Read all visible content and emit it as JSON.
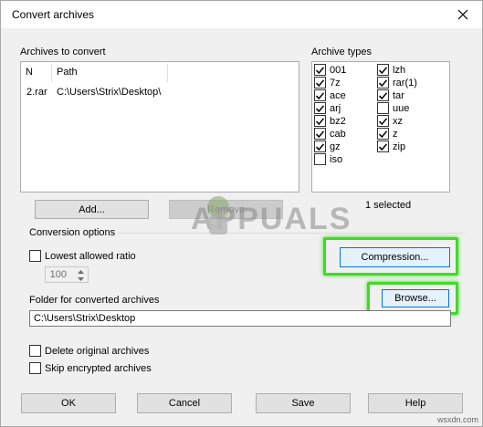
{
  "window": {
    "title": "Convert archives"
  },
  "archives": {
    "label": "Archives to convert",
    "columns": {
      "n": "N",
      "path": "Path"
    },
    "rows": [
      {
        "n": "2.rar",
        "path": "C:\\Users\\Strix\\Desktop\\"
      }
    ],
    "add_label": "Add...",
    "remove_label": "Remove"
  },
  "archive_types": {
    "label": "Archive types",
    "left": [
      {
        "name": "001",
        "checked": true
      },
      {
        "name": "7z",
        "checked": true
      },
      {
        "name": "ace",
        "checked": true
      },
      {
        "name": "arj",
        "checked": true
      },
      {
        "name": "bz2",
        "checked": true
      },
      {
        "name": "cab",
        "checked": true
      },
      {
        "name": "gz",
        "checked": true
      },
      {
        "name": "iso",
        "checked": false
      }
    ],
    "right": [
      {
        "name": "lzh",
        "checked": true
      },
      {
        "name": "rar(1)",
        "checked": true
      },
      {
        "name": "tar",
        "checked": true
      },
      {
        "name": "uue",
        "checked": false
      },
      {
        "name": "xz",
        "checked": true
      },
      {
        "name": "z",
        "checked": true
      },
      {
        "name": "zip",
        "checked": true
      }
    ],
    "selected_text": "1 selected"
  },
  "conversion": {
    "label": "Conversion options",
    "lowest_ratio_label": "Lowest allowed ratio",
    "lowest_ratio_checked": false,
    "ratio_value": "100",
    "compression_label": "Compression..."
  },
  "folder": {
    "label": "Folder for converted archives",
    "value": "C:\\Users\\Strix\\Desktop",
    "browse_label": "Browse..."
  },
  "options": {
    "delete_original": "Delete original archives",
    "delete_original_checked": false,
    "skip_encrypted": "Skip encrypted archives",
    "skip_encrypted_checked": false
  },
  "buttons": {
    "ok": "OK",
    "cancel": "Cancel",
    "save": "Save",
    "help": "Help"
  },
  "watermark": {
    "text": "APPUALS"
  },
  "footer": {
    "site": "wsxdn.com"
  },
  "colors": {
    "highlight": "#3ddc24",
    "focus_border": "#0078d7"
  }
}
